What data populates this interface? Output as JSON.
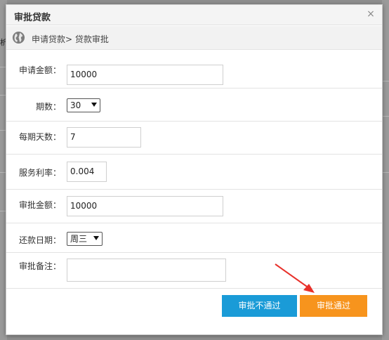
{
  "dialog": {
    "title": "审批贷款",
    "close_glyph": "×"
  },
  "breadcrumb": {
    "icon": "globe-icon",
    "text": "申请贷款> 贷款审批"
  },
  "background": {
    "partial_char": "析"
  },
  "form": {
    "apply_amount": {
      "label": "申请金额：",
      "value": "10000"
    },
    "periods": {
      "label": "期数：",
      "value": "30"
    },
    "days_per_period": {
      "label": "每期天数：",
      "value": "7"
    },
    "service_rate": {
      "label": "服务利率：",
      "value": "0.004"
    },
    "approved_amount": {
      "label": "审批金额：",
      "value": "10000"
    },
    "repay_day": {
      "label": "还款日期：",
      "value": "周三"
    },
    "remark": {
      "label": "审批备注：",
      "value": ""
    }
  },
  "buttons": {
    "reject": "审批不通过",
    "approve": "审批通过"
  },
  "colors": {
    "reject_button": "#1a9bd7",
    "approve_button": "#f7941d",
    "annotation_arrow": "#e8302a"
  }
}
